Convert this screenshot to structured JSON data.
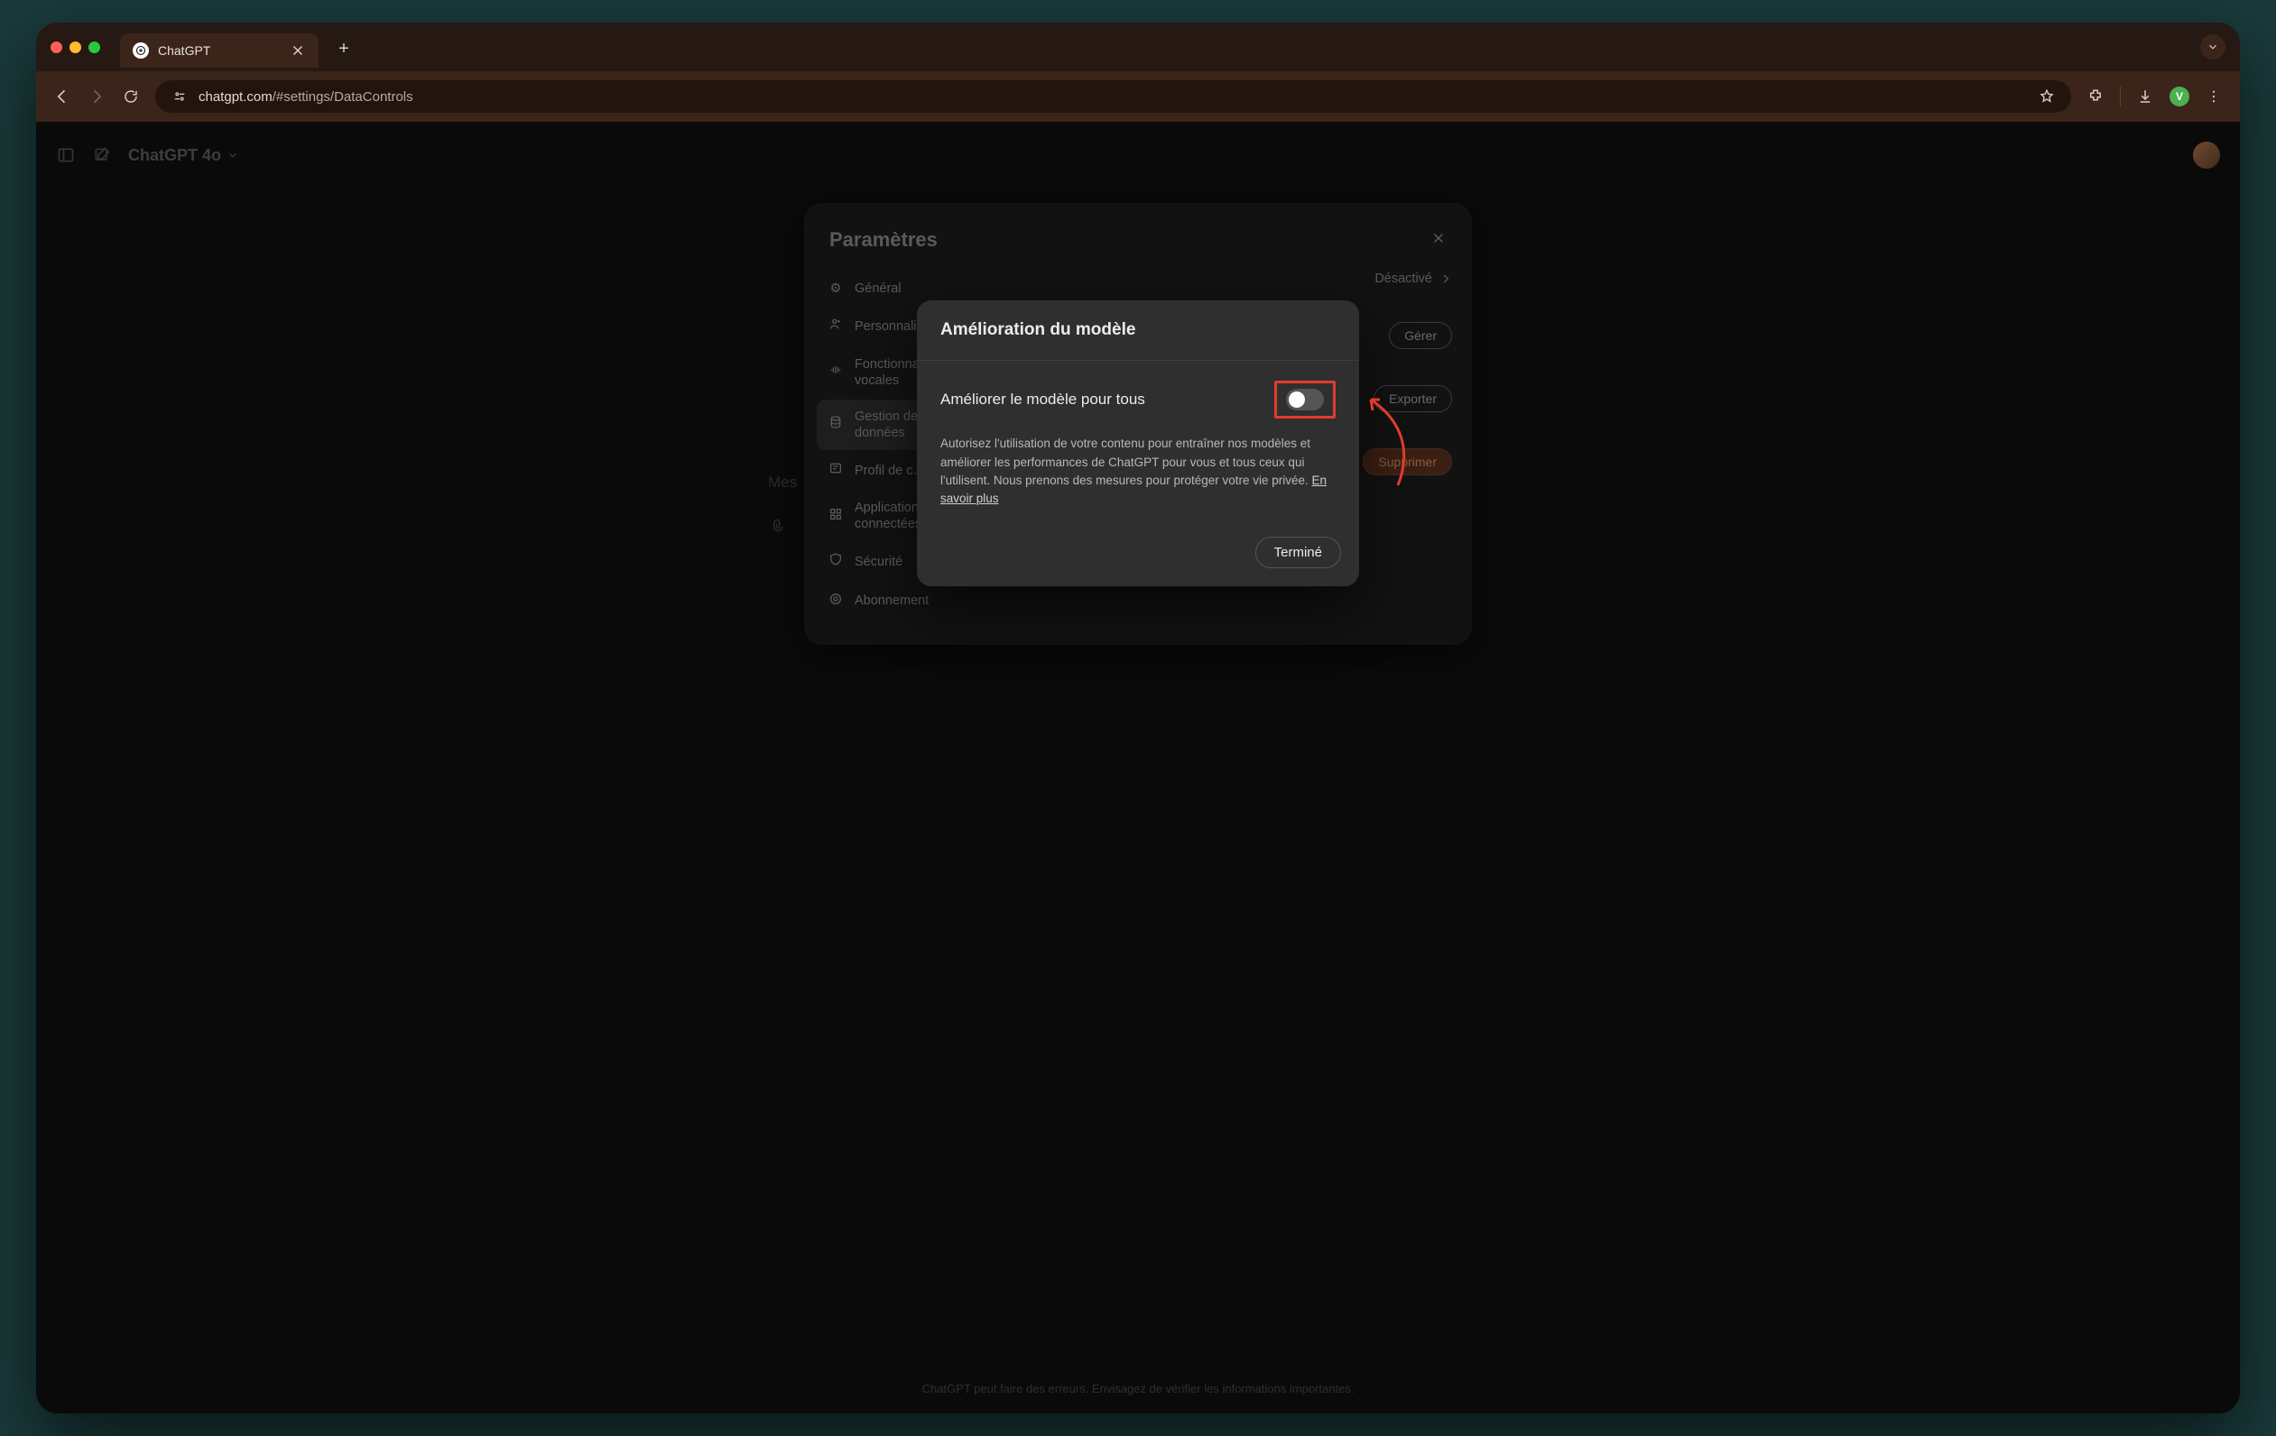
{
  "browser": {
    "tab_title": "ChatGPT",
    "url_display": "chatgpt.com/#settings/DataControls",
    "url_prefix": "chatgpt.com",
    "url_suffix": "/#settings/DataControls",
    "avatar_initial": "V"
  },
  "app_header": {
    "model_label": "ChatGPT 4o"
  },
  "app_footnote": "ChatGPT peut faire des erreurs. Envisagez de vérifier les informations importantes.",
  "settings": {
    "title": "Paramètres",
    "nav": [
      {
        "label": "Général"
      },
      {
        "label": "Personnalis…"
      },
      {
        "label": "Fonctionnalités\nvocales"
      },
      {
        "label": "Gestion des\ndonnées"
      },
      {
        "label": "Profil de c…"
      },
      {
        "label": "Applications\nconnectées"
      },
      {
        "label": "Sécurité"
      },
      {
        "label": "Abonnement"
      }
    ],
    "right": {
      "status_label": "Désactivé",
      "manage_btn": "Gérer",
      "export_btn": "Exporter",
      "delete_btn": "Supprimer"
    },
    "side_hint": "Mes"
  },
  "dialog": {
    "title": "Amélioration du modèle",
    "toggle_label": "Améliorer le modèle pour tous",
    "description": "Autorisez l'utilisation de votre contenu pour entraîner nos modèles et améliorer les performances de ChatGPT pour vous et tous ceux qui l'utilisent. Nous prenons des mesures pour protéger votre vie privée. ",
    "learn_more": "En savoir plus",
    "done": "Terminé",
    "toggle_on": false
  }
}
